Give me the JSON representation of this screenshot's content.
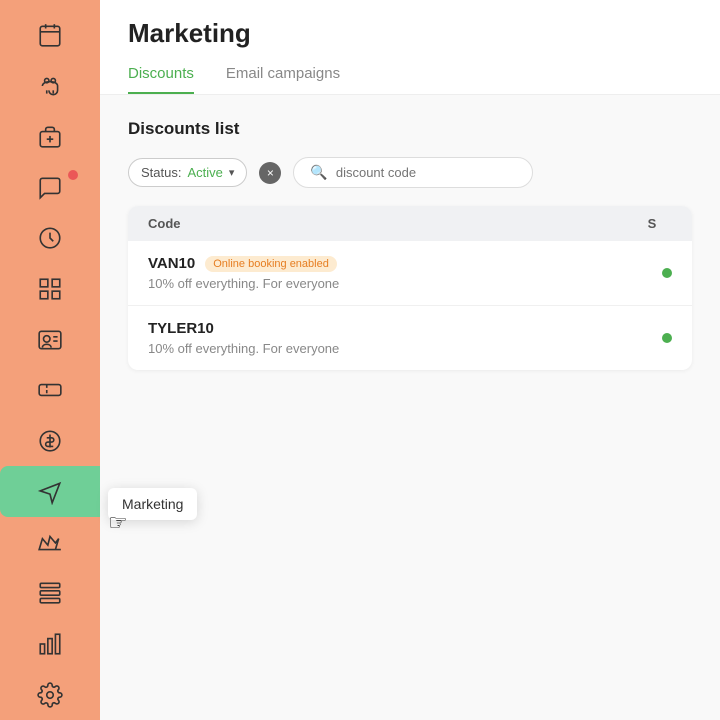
{
  "sidebar": {
    "items": [
      {
        "name": "calendar-icon",
        "icon": "calendar"
      },
      {
        "name": "dog-icon",
        "icon": "dog"
      },
      {
        "name": "box-icon",
        "icon": "box"
      },
      {
        "name": "chat-icon",
        "icon": "chat",
        "badge": true
      },
      {
        "name": "clock-icon",
        "icon": "clock"
      },
      {
        "name": "grid-icon",
        "icon": "grid"
      },
      {
        "name": "contact-icon",
        "icon": "contact"
      },
      {
        "name": "coupon-icon",
        "icon": "coupon"
      },
      {
        "name": "dollar-icon",
        "icon": "dollar"
      },
      {
        "name": "marketing-icon",
        "icon": "marketing",
        "active": true
      },
      {
        "name": "crown-icon",
        "icon": "crown"
      },
      {
        "name": "settings2-icon",
        "icon": "settings2"
      },
      {
        "name": "chart-icon",
        "icon": "chart"
      },
      {
        "name": "gear-icon",
        "icon": "gear"
      }
    ],
    "tooltip": "Marketing"
  },
  "header": {
    "title": "Marketing",
    "tabs": [
      {
        "label": "Discounts",
        "active": true
      },
      {
        "label": "Email campaigns",
        "active": false
      }
    ]
  },
  "content": {
    "section_title": "Discounts list",
    "filter": {
      "label": "Status:",
      "value": "Active",
      "clear_label": "×"
    },
    "search": {
      "placeholder": "discount code"
    },
    "table": {
      "columns": [
        {
          "label": "Code"
        },
        {
          "label": "S"
        }
      ],
      "rows": [
        {
          "code": "VAN10",
          "tag": "Online booking enabled",
          "description": "10% off everything. For everyone",
          "status_active": true
        },
        {
          "code": "TYLER10",
          "tag": null,
          "description": "10% off everything. For everyone",
          "status_active": true
        }
      ]
    }
  }
}
